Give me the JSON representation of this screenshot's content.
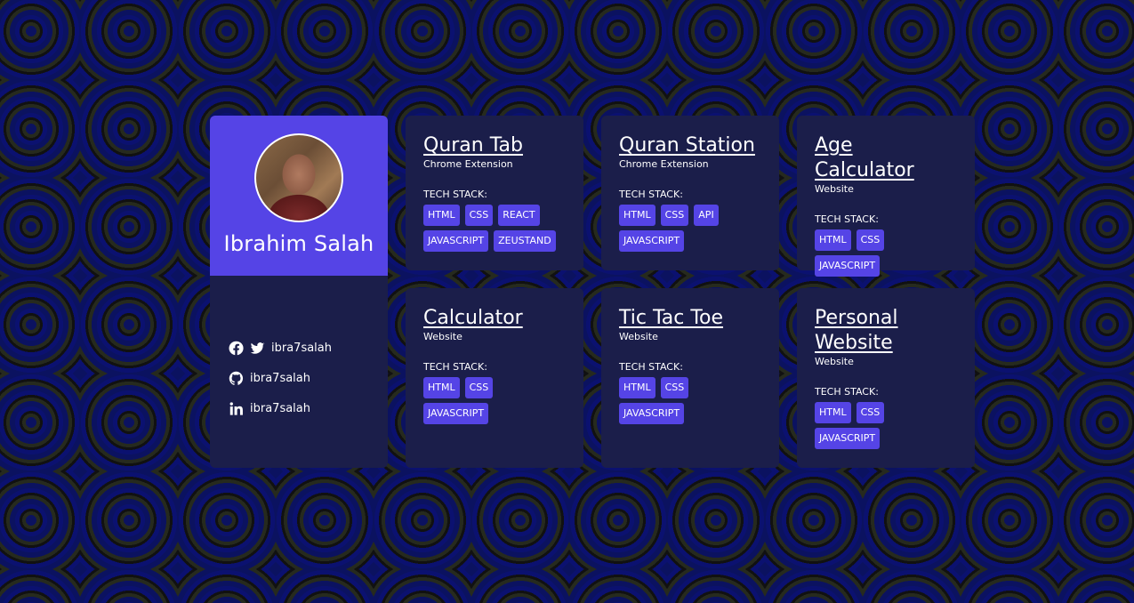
{
  "profile": {
    "name": "Ibrahim Salah",
    "socials": [
      {
        "icons": [
          "facebook-icon",
          "twitter-icon"
        ],
        "handle": "ibra7salah"
      },
      {
        "icons": [
          "github-icon"
        ],
        "handle": "ibra7salah"
      },
      {
        "icons": [
          "linkedin-icon"
        ],
        "handle": "ibra7salah"
      }
    ]
  },
  "projects": [
    {
      "title": "Quran Tab",
      "type": "Chrome Extension",
      "tech_label": "TECH STACK:",
      "tags": [
        "HTML",
        "CSS",
        "REACT",
        "JAVASCRIPT",
        "ZEUSTAND"
      ]
    },
    {
      "title": "Quran Station",
      "type": "Chrome Extension",
      "tech_label": "TECH STACK:",
      "tags": [
        "HTML",
        "CSS",
        "API",
        "JAVASCRIPT"
      ]
    },
    {
      "title": "Age Calculator",
      "type": "Website",
      "tech_label": "TECH STACK:",
      "tags": [
        "HTML",
        "CSS",
        "JAVASCRIPT"
      ]
    },
    {
      "title": "Calculator",
      "type": "Website",
      "tech_label": "TECH STACK:",
      "tags": [
        "HTML",
        "CSS",
        "JAVASCRIPT"
      ]
    },
    {
      "title": "Tic Tac Toe",
      "type": "Website",
      "tech_label": "TECH STACK:",
      "tags": [
        "HTML",
        "CSS",
        "JAVASCRIPT"
      ]
    },
    {
      "title": "Personal Website",
      "type": "Website",
      "tech_label": "TECH STACK:",
      "tags": [
        "HTML",
        "CSS",
        "JAVASCRIPT"
      ]
    }
  ],
  "colors": {
    "accent": "#5544e6",
    "card_bg": "#1b1e4a",
    "text": "#ffffff"
  }
}
